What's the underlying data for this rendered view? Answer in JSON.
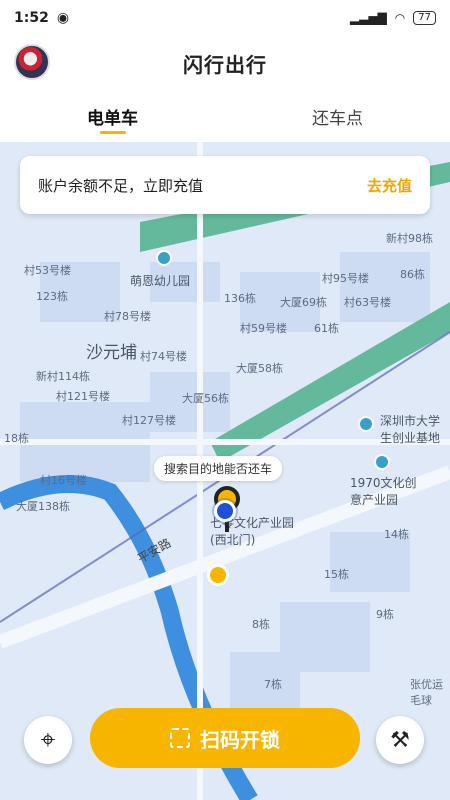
{
  "status_bar": {
    "time": "1:52",
    "battery": "77"
  },
  "header": {
    "title": "闪行出行"
  },
  "tabs": [
    {
      "label": "电单车"
    },
    {
      "label": "还车点"
    }
  ],
  "notice": {
    "text": "账户余额不足，立即充值",
    "action": "去充值"
  },
  "map": {
    "labels": [
      "萌恩幼儿园",
      "沙元埔",
      "村53号楼",
      "123栋",
      "村78号楼",
      "136栋",
      "大厦69栋",
      "村63号楼",
      "村95号楼",
      "86栋",
      "村59号楼",
      "61栋",
      "村74号楼",
      "大厦58栋",
      "新村114栋",
      "村121号楼",
      "大厦56栋",
      "村127号楼",
      "18栋",
      "村16号楼",
      "大厦138栋",
      "深圳市大学生创业基地",
      "1970文化创意产业园",
      "七零文化产业园(西北门)",
      "14栋",
      "15栋",
      "9栋",
      "8栋",
      "7栋",
      "新村98栋",
      "平安路",
      "张优运毛球"
    ],
    "tooltip": "搜索目的地能否还车"
  },
  "bottom": {
    "scan_button": "扫码开锁"
  },
  "colors": {
    "accent": "#f7b500",
    "map_bg": "#dfe9f7",
    "green_strip": "#4fb08c"
  }
}
